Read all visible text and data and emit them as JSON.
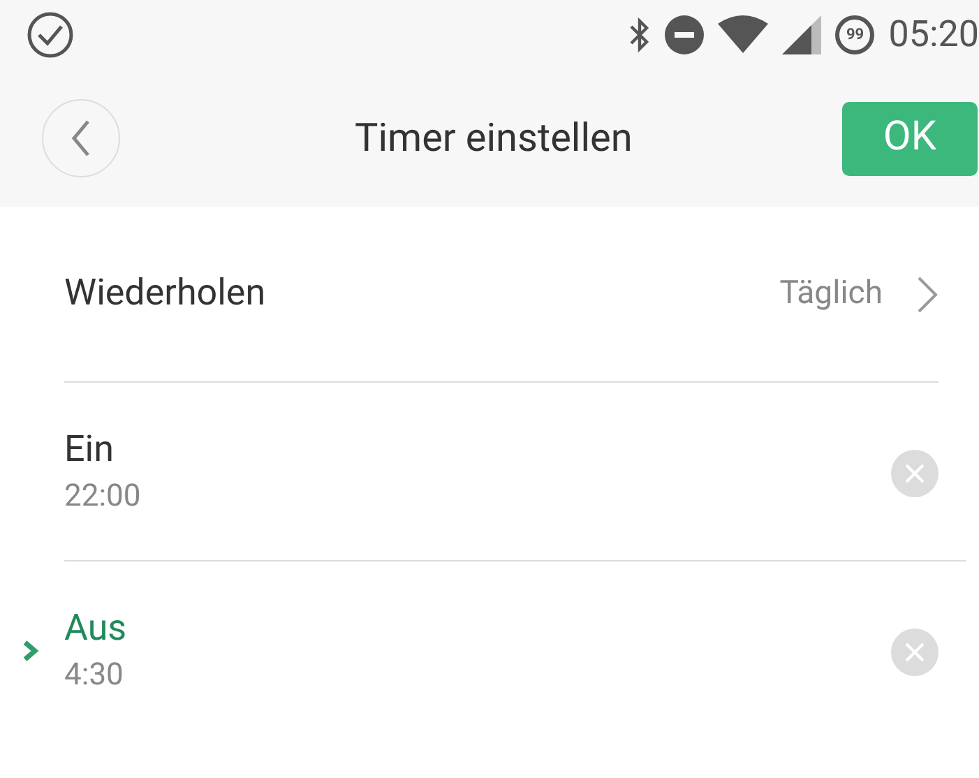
{
  "status_bar": {
    "battery": "99",
    "time": "05:20"
  },
  "header": {
    "title": "Timer einstellen",
    "ok_button": "OK"
  },
  "repeat": {
    "label": "Wiederholen",
    "value": "Täglich"
  },
  "timers": [
    {
      "label": "Ein",
      "time": "22:00",
      "selected": false
    },
    {
      "label": "Aus",
      "time": "4:30",
      "selected": true
    }
  ]
}
